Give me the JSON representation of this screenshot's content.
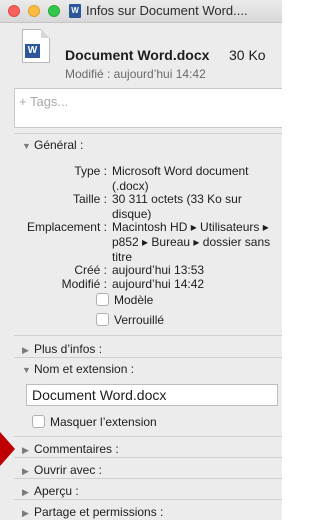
{
  "window": {
    "title": "Infos sur Document Word....",
    "title_icon": "W"
  },
  "header": {
    "icon_badge": "W",
    "file_name": "Document Word.docx",
    "size": "30 Ko",
    "modified": "Modifié : aujourd’hui 14:42"
  },
  "tags": {
    "placeholder": "+ Tags..."
  },
  "general": {
    "heading": "Général :",
    "rows": [
      {
        "label": "Type :",
        "value": "Microsoft Word document (.docx)"
      },
      {
        "label": "Taille :",
        "value": "30 311 octets (33 Ko sur disque)"
      },
      {
        "label": "Emplacement :",
        "value": "Macintosh HD ▸ Utilisateurs ▸ p852 ▸ Bureau ▸ dossier sans titre"
      },
      {
        "label": "Créé :",
        "value": "aujourd’hui 13:53"
      },
      {
        "label": "Modifié :",
        "value": "aujourd’hui 14:42"
      }
    ],
    "model_label": "Modèle",
    "locked_label": "Verrouillé"
  },
  "more_info": {
    "heading": "Plus d’infos :"
  },
  "name_ext": {
    "heading": "Nom et extension :",
    "value": "Document Word.docx",
    "hide_ext_label": "Masquer l’extension"
  },
  "comments": {
    "heading": "Commentaires :"
  },
  "open_with": {
    "heading": "Ouvrir avec :"
  },
  "preview": {
    "heading": "Aperçu :"
  },
  "sharing": {
    "heading": "Partage et permissions :"
  },
  "colors": {
    "word_blue": "#2b579a",
    "close": "#fc605c",
    "minimize": "#fdbc40",
    "zoom": "#34c84a",
    "annotation_arrow": "#c00000"
  }
}
